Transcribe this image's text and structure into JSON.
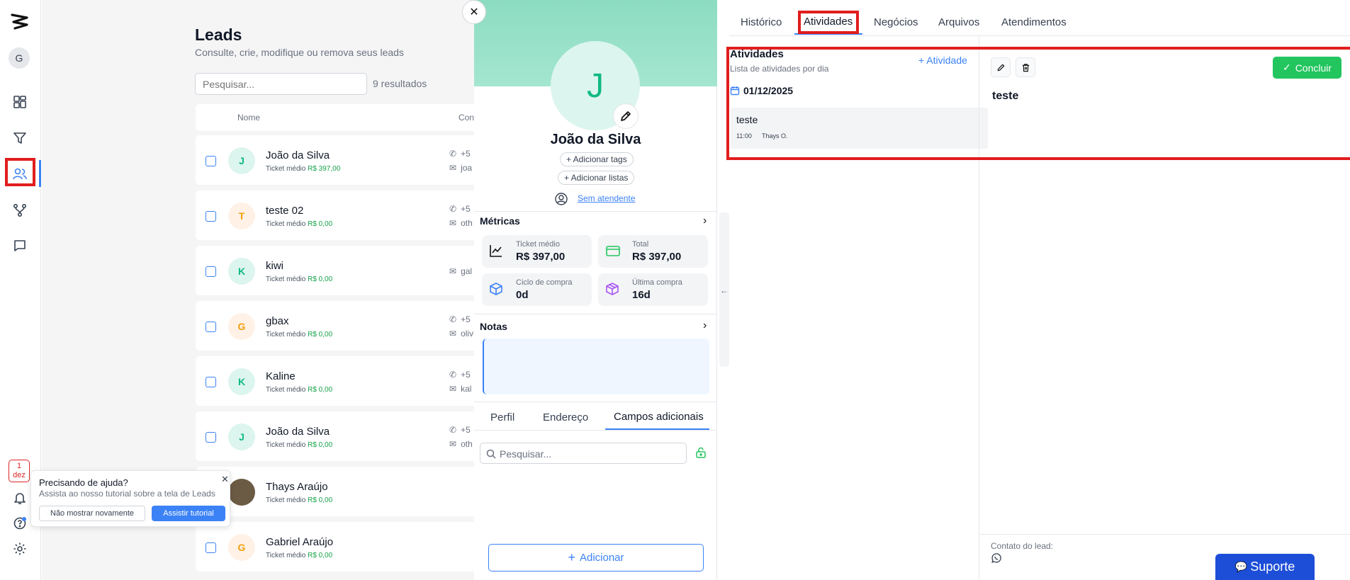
{
  "rail": {
    "avatar": "G",
    "date_day": "1",
    "date_month": "dez"
  },
  "page": {
    "title": "Leads",
    "subtitle": "Consulte, crie, modifique ou remova seus leads",
    "search_placeholder": "Pesquisar...",
    "result_count": "9 resultados",
    "col_name": "Nome",
    "col_contact": "Con"
  },
  "rows": [
    {
      "initial": "J",
      "name": "João da Silva",
      "ticket_label": "Ticket médio",
      "ticket": "R$ 397,00",
      "phone": "+5",
      "email": "joa"
    },
    {
      "initial": "T",
      "name": "teste 02",
      "ticket_label": "Ticket médio",
      "ticket": "R$ 0,00",
      "phone": "+5",
      "email": "oth"
    },
    {
      "initial": "K",
      "name": "kiwi",
      "ticket_label": "Ticket médio",
      "ticket": "R$ 0,00",
      "phone": "",
      "email": "gal"
    },
    {
      "initial": "G",
      "name": "gbax",
      "ticket_label": "Ticket médio",
      "ticket": "R$ 0,00",
      "phone": "+5",
      "email": "oliv"
    },
    {
      "initial": "K",
      "name": "Kaline",
      "ticket_label": "Ticket médio",
      "ticket": "R$ 0,00",
      "phone": "+5",
      "email": "kal"
    },
    {
      "initial": "J",
      "name": "João da Silva",
      "ticket_label": "Ticket médio",
      "ticket": "R$ 0,00",
      "phone": "+5",
      "email": "oth"
    },
    {
      "initial": "",
      "name": "Thays Araújo",
      "ticket_label": "Ticket médio",
      "ticket": "R$ 0,00",
      "phone": "",
      "email": ""
    },
    {
      "initial": "G",
      "name": "Gabriel Araújo",
      "ticket_label": "Ticket médio",
      "ticket": "R$ 0,00",
      "phone": "",
      "email": ""
    }
  ],
  "help": {
    "title": "Precisando de ajuda?",
    "text": "Assista ao nosso tutorial sobre a tela de Leads",
    "dismiss": "Não mostrar novamente",
    "watch": "Assistir tutorial"
  },
  "lead": {
    "initial": "J",
    "name": "João da Silva",
    "add_tags": "+ Adicionar tags",
    "add_lists": "+ Adicionar listas",
    "attendant": "Sem atendente",
    "metrics_title": "Métricas",
    "metrics": [
      {
        "label": "Ticket médio",
        "value": "R$ 397,00"
      },
      {
        "label": "Total",
        "value": "R$ 397,00"
      },
      {
        "label": "Ciclo de compra",
        "value": "0d"
      },
      {
        "label": "Última compra",
        "value": "16d"
      }
    ],
    "notes_title": "Notas",
    "tabs": [
      "Perfil",
      "Endereço",
      "Campos adicionais"
    ],
    "search_placeholder": "Pesquisar...",
    "add_button": "Adicionar"
  },
  "right": {
    "tabs": [
      "Histórico",
      "Atividades",
      "Negócios",
      "Arquivos",
      "Atendimentos"
    ],
    "activities_title": "Atividades",
    "activities_subtitle": "Lista de atividades por dia",
    "add_activity": "+ Atividade",
    "date": "01/12/2025",
    "activity_title": "teste",
    "activity_time": "11:00",
    "activity_user": "Thays O.",
    "conclude": "Concluir",
    "detail_title": "teste",
    "contact_label": "Contato do lead:",
    "support": "Suporte"
  },
  "colors": {
    "accent": "#3b82f6",
    "green": "#22c55e",
    "red": "#e11d1d",
    "support": "#1d4ed8"
  }
}
